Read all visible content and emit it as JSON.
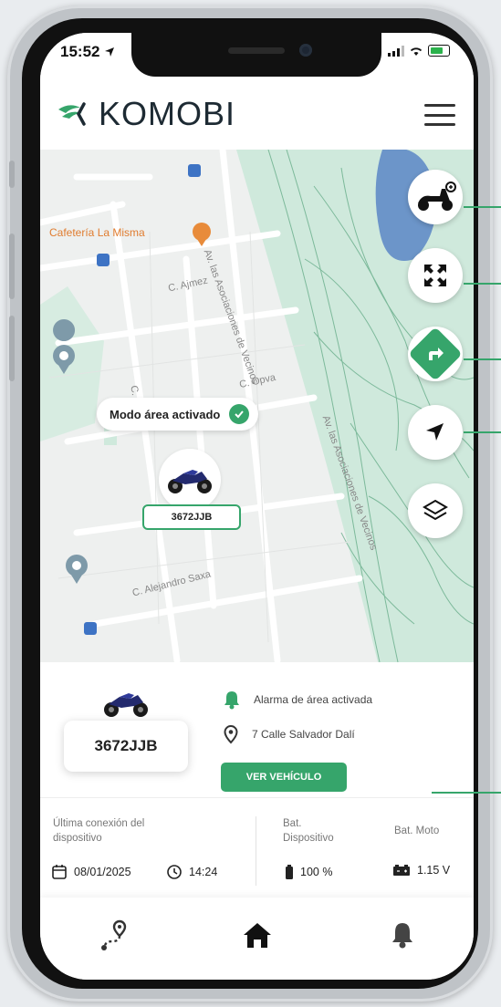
{
  "status_bar": {
    "time": "15:52"
  },
  "header": {
    "brand": "KOMOBI"
  },
  "map": {
    "streets": {
      "ajmez": "C. Ajmez",
      "opva": "C. Opva",
      "fanb": "C. Fanb",
      "alejandro": "C. Alejandro Saxa",
      "avenida_top": "Av. las Asociaciones de Vecinos",
      "avenida_bottom": "Av. las Asociaciones de Vecinos"
    },
    "poi": "Cafetería La Misma",
    "mode_chip": "Modo área activado",
    "plate": "3672JJB"
  },
  "info": {
    "plate": "3672JJB",
    "alarm": "Alarma de área activada",
    "address": "7 Calle Salvador Dalí",
    "view_button": "VER VEHÍCULO"
  },
  "stats": {
    "last_connection_label_1": "Última conexión del",
    "last_connection_label_2": "dispositivo",
    "date": "08/01/2025",
    "time": "14:24",
    "device_battery_label_1": "Bat.",
    "device_battery_label_2": "Dispositivo",
    "device_battery": "100 %",
    "moto_battery_label": "Bat. Moto",
    "moto_battery": "1.15 V"
  },
  "colors": {
    "accent": "#36a56b",
    "map_park": "#cfe9dc",
    "water": "#6c95c9"
  }
}
